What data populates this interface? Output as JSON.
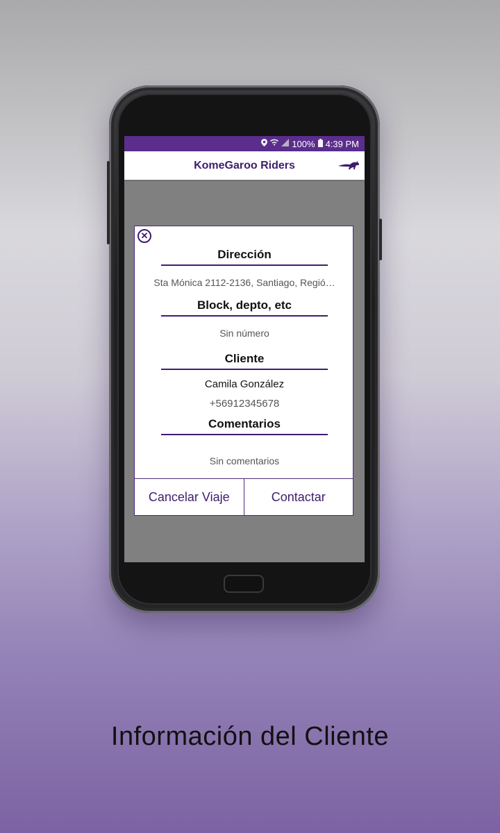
{
  "status_bar": {
    "battery": "100%",
    "time": "4:39 PM",
    "icons": [
      "location-icon",
      "wifi-icon",
      "signal-icon",
      "battery-icon"
    ]
  },
  "app_bar": {
    "title": "KomeGaroo Riders",
    "logo": "kangaroo-logo"
  },
  "dialog": {
    "close_icon": "close-circle-icon",
    "direccion_title": "Dirección",
    "direccion_value": "Sta Mónica 2112-2136, Santiago, Regió…",
    "block_title": "Block, depto, etc",
    "block_value": "Sin número",
    "cliente_title": "Cliente",
    "cliente_name": "Camila González",
    "cliente_phone": "+56912345678",
    "comentarios_title": "Comentarios",
    "comentarios_value": "Sin comentarios",
    "cancel_label": "Cancelar Viaje",
    "contact_label": "Contactar"
  },
  "caption": "Información del Cliente",
  "colors": {
    "brand_purple": "#5b2d8c",
    "text_purple": "#3f1c6e",
    "overlay_gray": "#808080"
  }
}
